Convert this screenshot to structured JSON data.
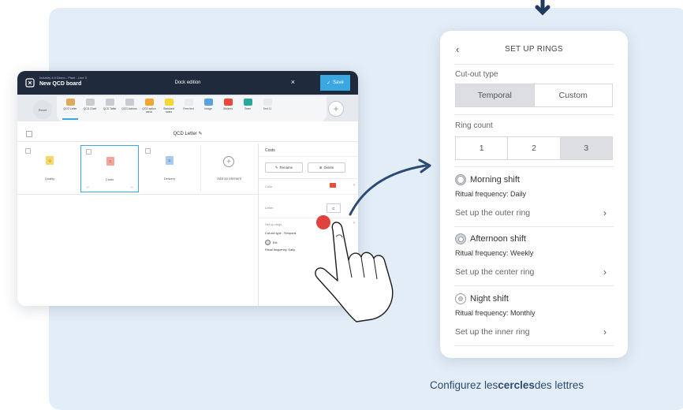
{
  "app": {
    "subtitle": "Industry 4.0 Demo - Plant - Line 3",
    "board_title": "New QCD board",
    "mode_title": "Dock edition",
    "close_label": "×",
    "save_label": "Save",
    "reset_label": "Reset",
    "toolbar_items": [
      {
        "label": "QCD Letter",
        "color": "#e1a85f"
      },
      {
        "label": "QCD Chart",
        "color": "#c8ccd2"
      },
      {
        "label": "QCD Table",
        "color": "#c8ccd2"
      },
      {
        "label": "QCD Actions",
        "color": "#c8ccd2"
      },
      {
        "label": "QCD action cards",
        "color": "#f2a531"
      },
      {
        "label": "Standard notes",
        "color": "#f5d634"
      },
      {
        "label": "Free text",
        "color": "#e9ecef"
      },
      {
        "label": "Image",
        "color": "#5aa2dd"
      },
      {
        "label": "Stickers",
        "color": "#e8493b"
      },
      {
        "label": "Team",
        "color": "#29a79b"
      },
      {
        "label": "Text 11",
        "color": "#e9ecef"
      }
    ],
    "letter_bar_label": "QCD Letter",
    "cards": [
      {
        "letter": "Q",
        "name": "Quality",
        "color": "#f5d86c"
      },
      {
        "letter": "C",
        "name": "Costs",
        "color": "#f4a59a"
      },
      {
        "letter": "D",
        "name": "Delivery",
        "color": "#a9c9ee"
      }
    ],
    "add_element_label": "Add an element",
    "side_panel": {
      "title": "Costs",
      "rename_label": "Rename",
      "delete_label": "Delete",
      "color_label": "Color",
      "letter_label": "Letter",
      "letter_value": "C",
      "set_up_rings_label": "Set up rings",
      "cutout_line": "Cut-out type : Temporal",
      "ring_name": "Ext.",
      "ritual_line": "Ritual frequency: Daily"
    }
  },
  "panel": {
    "back_icon": "‹",
    "title": "SET UP RINGS",
    "cutout_label": "Cut-out type",
    "cutout_options": [
      "Temporal",
      "Custom"
    ],
    "cutout_selected": "Temporal",
    "ring_count_label": "Ring count",
    "ring_count_options": [
      "1",
      "2",
      "3"
    ],
    "ring_count_selected": "3",
    "shifts": [
      {
        "name": "Morning shift",
        "frequency": "Ritual frequency: Daily",
        "link": "Set up the outer ring"
      },
      {
        "name": "Afternoon shift",
        "frequency": "Ritual frequency: Weekly",
        "link": "Set up the center ring"
      },
      {
        "name": "Night shift",
        "frequency": "Ritual frequency: Monthly",
        "link": "Set up the inner ring"
      }
    ]
  },
  "caption": {
    "before": "Configurez les ",
    "bold": "cercles",
    "after": " des lettres"
  }
}
